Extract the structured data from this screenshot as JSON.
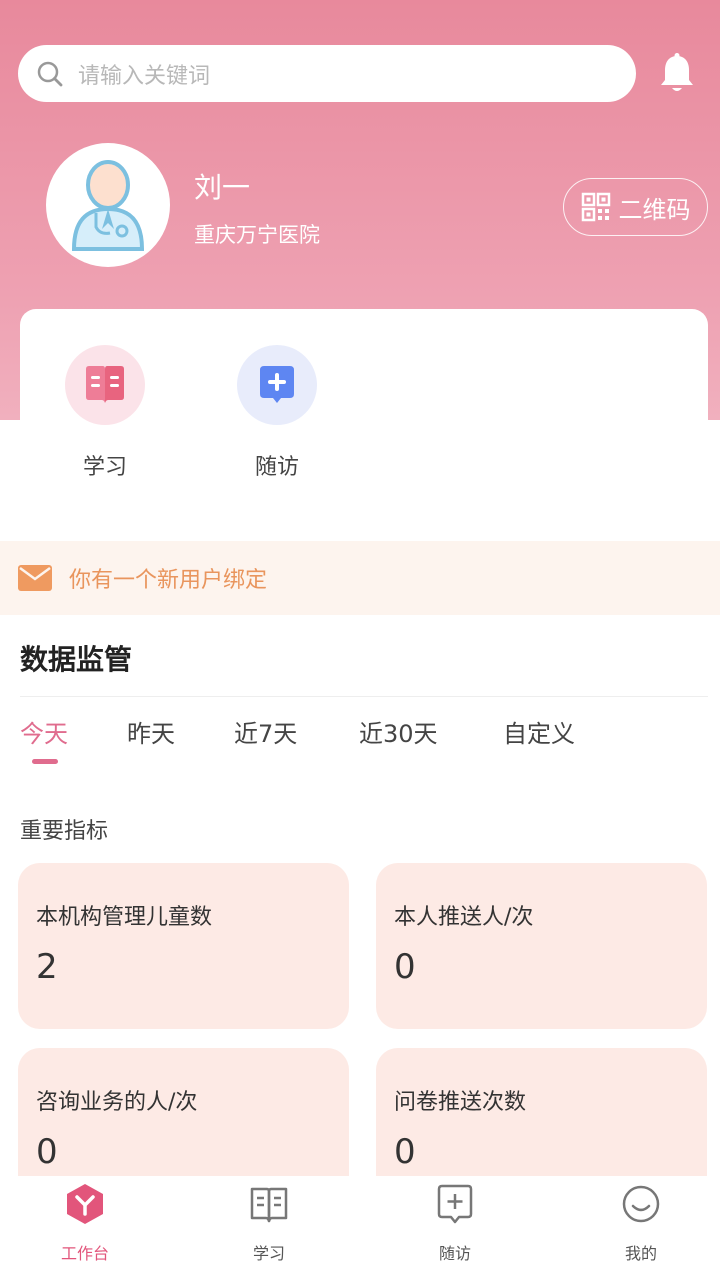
{
  "search": {
    "placeholder": "请输入关键词"
  },
  "user": {
    "name": "刘一",
    "organization": "重庆万宁医院"
  },
  "qr_button": {
    "label": "二维码"
  },
  "shortcuts": [
    {
      "label": "学习",
      "icon": "book-icon",
      "bg": "#fbe3e9",
      "color": "#ec6f8f"
    },
    {
      "label": "随访",
      "icon": "plus-box-icon",
      "bg": "#e8ecfb",
      "color": "#5e86f2"
    }
  ],
  "notice": {
    "text": "你有一个新用户绑定",
    "icon": "mail-icon"
  },
  "monitoring": {
    "title": "数据监管",
    "tabs": [
      "今天",
      "昨天",
      "近7天",
      "近30天",
      "自定义"
    ],
    "active_tab": "今天",
    "indicators_title": "重要指标",
    "metrics": [
      {
        "label": "本机构管理儿童数",
        "value": "2"
      },
      {
        "label": "本人推送人/次",
        "value": "0"
      },
      {
        "label": "咨询业务的人/次",
        "value": "0"
      },
      {
        "label": "问卷推送次数",
        "value": "0"
      }
    ]
  },
  "tabbar": [
    {
      "label": "工作台",
      "icon": "workbench-icon",
      "active": true
    },
    {
      "label": "学习",
      "icon": "book-icon",
      "active": false
    },
    {
      "label": "随访",
      "icon": "plus-box-icon",
      "active": false
    },
    {
      "label": "我的",
      "icon": "smile-icon",
      "active": false
    }
  ],
  "colors": {
    "header_gradient_top": "#e8899c",
    "accent": "#e06c8e",
    "metric_card_bg": "#fdeae5",
    "notice_bg": "#fdf4ee",
    "notice_text": "#e9955d"
  }
}
